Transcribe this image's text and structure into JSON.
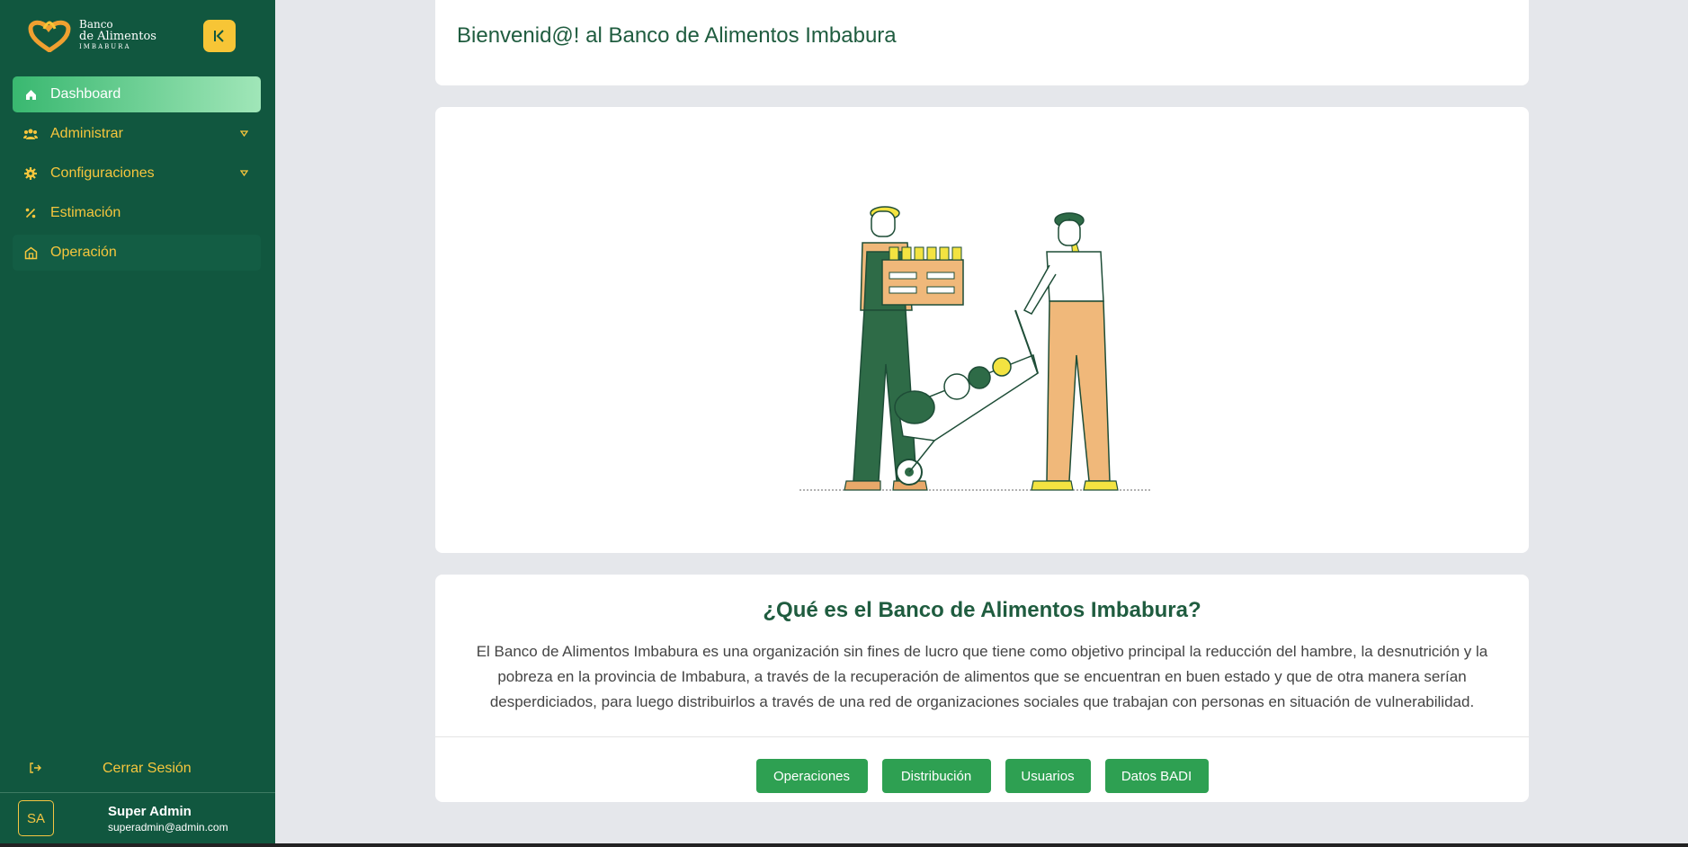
{
  "brand": {
    "line1": "Banco",
    "line2": "de Alimentos",
    "line3": "IMBABURA",
    "collapse_icon": "collapse-icon"
  },
  "sidebar": {
    "items": [
      {
        "label": "Dashboard",
        "icon": "home-icon",
        "active": true
      },
      {
        "label": "Administrar",
        "icon": "users-icon",
        "has_submenu": true
      },
      {
        "label": "Configuraciones",
        "icon": "gear-icon",
        "has_submenu": true
      },
      {
        "label": "Estimación",
        "icon": "percent-icon"
      },
      {
        "label": "Operación",
        "icon": "warehouse-icon"
      }
    ],
    "logout_label": "Cerrar Sesión"
  },
  "user": {
    "initials": "SA",
    "name": "Super Admin",
    "email": "superadmin@admin.com"
  },
  "main": {
    "welcome": "Bienvenid@! al Banco de Alimentos Imbabura",
    "info_title": "¿Qué es el Banco de Alimentos Imbabura?",
    "info_text": "El Banco de Alimentos Imbabura es una organización sin fines de lucro que tiene como objetivo principal la reducción del hambre, la desnutrición y la pobreza en la provincia de Imbabura, a través de la recuperación de alimentos que se encuentran en buen estado y que de otra manera serían desperdiciados, para luego distribuirlos a través de una red de organizaciones sociales que trabajan con personas en situación de vulnerabilidad.",
    "buttons": [
      "Operaciones",
      "Distribución",
      "Usuarios",
      "Datos BADI"
    ]
  },
  "colors": {
    "sidebar_bg": "#11573f",
    "accent_yellow": "#f7c536",
    "button_green": "#2ea052",
    "heading_green": "#1f5c3f"
  }
}
